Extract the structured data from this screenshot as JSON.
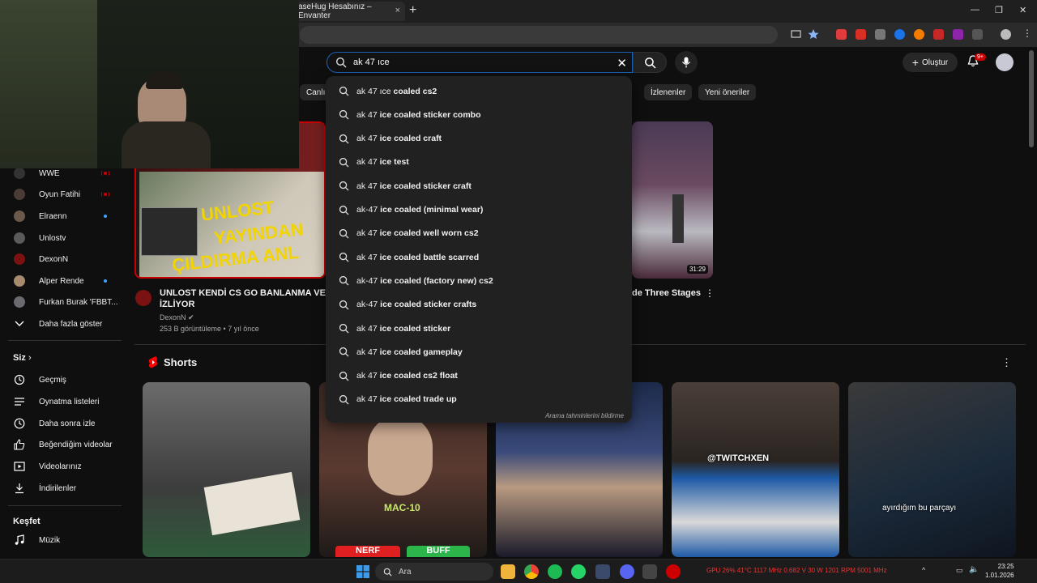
{
  "browser": {
    "tab_title": "aseHug Hesabınız – Envanter",
    "tab_close": "×",
    "new_tab": "+"
  },
  "header": {
    "search_value": "ak 47 ıce",
    "create_label": "Oluştur",
    "notifications_count": "9+"
  },
  "chips": [
    "Canlı",
    "İzlenenler",
    "Yeni öneriler"
  ],
  "sidebar": {
    "subscriptions": [
      {
        "label": "WWE",
        "status": "live"
      },
      {
        "label": "Oyun Fatihi",
        "status": "live"
      },
      {
        "label": "Elraenn",
        "status": "new"
      },
      {
        "label": "Unlostv",
        "status": ""
      },
      {
        "label": "DexonN",
        "status": ""
      },
      {
        "label": "Alper Rende",
        "status": "new"
      },
      {
        "label": "Furkan Burak 'FBBT...",
        "status": ""
      }
    ],
    "show_more": "Daha fazla göster",
    "you_heading": "Siz",
    "you_items": [
      {
        "label": "Geçmiş",
        "icon": "history-icon"
      },
      {
        "label": "Oynatma listeleri",
        "icon": "playlist-icon"
      },
      {
        "label": "Daha sonra izle",
        "icon": "watch-later-icon"
      },
      {
        "label": "Beğendiğim videolar",
        "icon": "like-icon"
      },
      {
        "label": "Videolarınız",
        "icon": "your-videos-icon"
      },
      {
        "label": "İndirilenler",
        "icon": "download-icon"
      }
    ],
    "explore_heading": "Keşfet",
    "explore_items": [
      {
        "label": "Müzik",
        "icon": "music-icon"
      }
    ]
  },
  "main": {
    "video1": {
      "title_line1": "UNLOST KENDİ CS GO BANLANMA VE ÇILD",
      "title_line2": "İZLİYOR",
      "channel": "DexonN",
      "meta": "253 B görüntüleme • 7 yıl önce",
      "thumb_text1": "UNLOST",
      "thumb_text2": "YAYINDAN",
      "thumb_text3": "ÇILDIRMA ANL"
    },
    "video2": {
      "title": "de Three Stages",
      "duration": "31:29"
    },
    "shorts_label": "Shorts",
    "short_texts": {
      "mac": "MAC-10",
      "nerf": "NERF",
      "buff": "BUFF",
      "twitch": "@TWITCHXEN",
      "caption": "ayırdığım bu parçayı"
    }
  },
  "suggestions": {
    "typed_prefix": "ak 47 ıce",
    "items": [
      {
        "typed": "ak 47 ıce",
        "rest": " coaled cs2"
      },
      {
        "typed": "ak 47",
        "rest": " ice coaled sticker combo"
      },
      {
        "typed": "ak 47",
        "rest": " ice coaled craft"
      },
      {
        "typed": "ak 47",
        "rest": " ice test"
      },
      {
        "typed": "ak 47",
        "rest": " ice coaled sticker craft"
      },
      {
        "typed": "ak-47",
        "rest": " ice coaled (minimal wear)"
      },
      {
        "typed": "ak 47",
        "rest": " ice coaled well worn cs2"
      },
      {
        "typed": "ak 47",
        "rest": " ice coaled battle scarred"
      },
      {
        "typed": "ak-47",
        "rest": " ice coaled (factory new) cs2"
      },
      {
        "typed": "ak-47",
        "rest": " ice coaled sticker crafts"
      },
      {
        "typed": "ak 47",
        "rest": " ice coaled sticker"
      },
      {
        "typed": "ak 47",
        "rest": " ice coaled gameplay"
      },
      {
        "typed": "ak 47",
        "rest": " ice coaled cs2 float"
      },
      {
        "typed": "ak 47",
        "rest": " ice coaled trade up"
      }
    ],
    "report": "Arama tahminlerini bildirme"
  },
  "taskbar": {
    "search_label": "Ara",
    "tray_text": "GPU 26% 41°C 1117 MHz 0.682 V 30 W 1201 RPM 5001 MHz",
    "time": "23:25",
    "date": "1.01.2026"
  },
  "colors": {
    "accent_blue": "#3ea6ff",
    "live_red": "#cc0000",
    "search_border": "#1c62b9"
  }
}
